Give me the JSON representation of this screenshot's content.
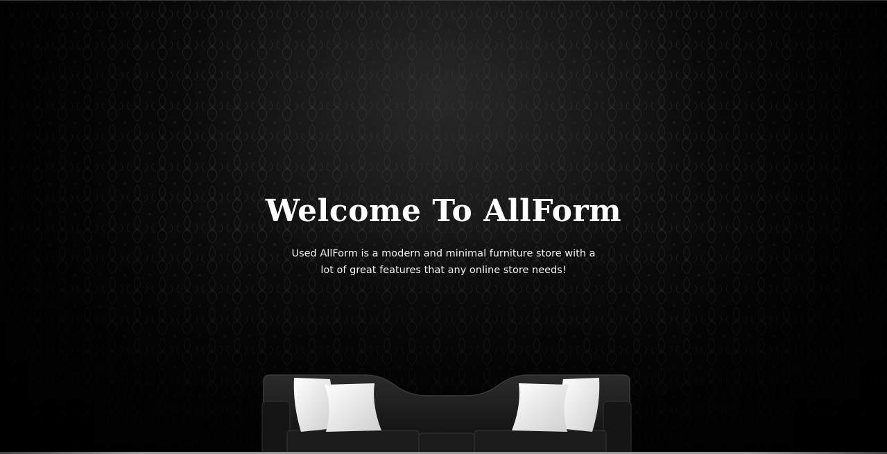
{
  "hero": {
    "title": "Welcome To AllForm",
    "subtitle": "Used AllForm is a modern and minimal furniture store with a lot of great features that any online store needs!"
  },
  "images": {
    "background": "black-damask-wallpaper",
    "sofa": "black-sofa-with-white-pillows"
  },
  "colors": {
    "background": "#060606",
    "text": "#ffffff",
    "pillow": "#f2f2f2",
    "sofa": "#1a1a1a"
  }
}
